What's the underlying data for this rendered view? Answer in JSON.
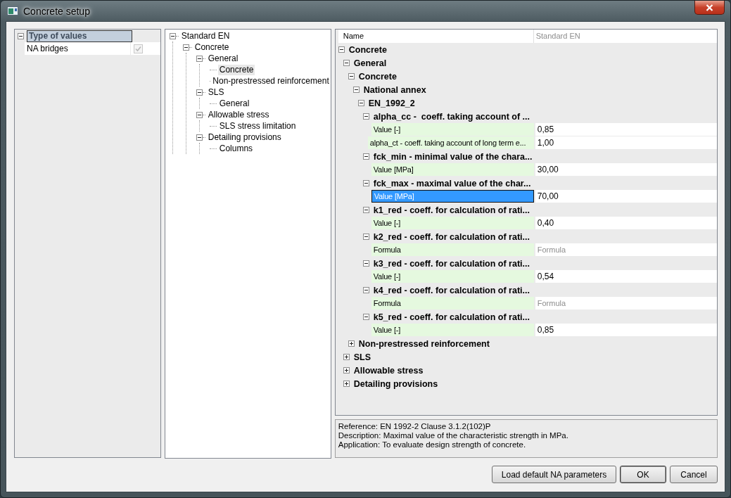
{
  "window": {
    "title": "Concrete setup"
  },
  "type_grid": {
    "category": {
      "label": "Type of values",
      "expanded": true,
      "selected": true
    },
    "items": [
      {
        "label": "NA bridges",
        "checked": true,
        "disabled": true
      }
    ]
  },
  "navigation_tree": {
    "items": [
      {
        "label": "Standard EN",
        "expanded": true,
        "selected": false,
        "children": [
          {
            "label": "Concrete",
            "expanded": true,
            "selected": false,
            "children": [
              {
                "label": "General",
                "expanded": true,
                "selected": false,
                "children": [
                  {
                    "label": "Concrete",
                    "selected": true
                  },
                  {
                    "label": "Non-prestressed reinforcement",
                    "selected": false
                  }
                ]
              },
              {
                "label": "SLS",
                "expanded": true,
                "selected": false,
                "children": [
                  {
                    "label": "General",
                    "selected": false
                  }
                ]
              },
              {
                "label": "Allowable stress",
                "expanded": true,
                "selected": false,
                "children": [
                  {
                    "label": "SLS stress limitation",
                    "selected": false
                  }
                ]
              },
              {
                "label": "Detailing provisions",
                "expanded": true,
                "selected": false,
                "children": [
                  {
                    "label": "Columns",
                    "selected": false
                  }
                ]
              }
            ]
          }
        ]
      }
    ]
  },
  "property_grid": {
    "columns": [
      "Name",
      "Standard EN"
    ],
    "rows": [
      {
        "kind": "category",
        "label": "Concrete",
        "expanded": true,
        "children": [
          {
            "kind": "category",
            "label": "General",
            "expanded": true,
            "children": [
              {
                "kind": "category",
                "label": "Concrete",
                "expanded": true,
                "children": [
                  {
                    "kind": "category",
                    "label": "National annex",
                    "expanded": true,
                    "children": [
                      {
                        "kind": "category",
                        "label": "EN_1992_2",
                        "expanded": true,
                        "children": [
                          {
                            "kind": "category",
                            "label": "alpha_cc -  coeff. taking account of ...",
                            "expanded": true,
                            "children": [
                              {
                                "kind": "value",
                                "label": "Value [-]",
                                "value": "0,85",
                                "selected": false,
                                "disabled": false
                              }
                            ]
                          },
                          {
                            "kind": "value",
                            "label": "alpha_ct - coeff. taking account of long term e...",
                            "value": "1,00",
                            "selected": false,
                            "disabled": false
                          },
                          {
                            "kind": "category",
                            "label": "fck_min - minimal value of the chara...",
                            "expanded": true,
                            "children": [
                              {
                                "kind": "value",
                                "label": "Value [MPa]",
                                "value": "30,00",
                                "selected": false,
                                "disabled": false
                              }
                            ]
                          },
                          {
                            "kind": "category",
                            "label": "fck_max - maximal value of the char...",
                            "expanded": true,
                            "children": [
                              {
                                "kind": "value",
                                "label": "Value [MPa]",
                                "value": "70,00",
                                "selected": true,
                                "disabled": false
                              }
                            ]
                          },
                          {
                            "kind": "category",
                            "label": "k1_red - coeff. for calculation of rati...",
                            "expanded": true,
                            "children": [
                              {
                                "kind": "value",
                                "label": "Value [-]",
                                "value": "0,40",
                                "selected": false,
                                "disabled": false
                              }
                            ]
                          },
                          {
                            "kind": "category",
                            "label": "k2_red - coeff. for calculation of rati...",
                            "expanded": true,
                            "children": [
                              {
                                "kind": "value",
                                "label": "Formula",
                                "value": "Formula",
                                "selected": false,
                                "disabled": true
                              }
                            ]
                          },
                          {
                            "kind": "category",
                            "label": "k3_red - coeff. for calculation of rati...",
                            "expanded": true,
                            "children": [
                              {
                                "kind": "value",
                                "label": "Value [-]",
                                "value": "0,54",
                                "selected": false,
                                "disabled": false
                              }
                            ]
                          },
                          {
                            "kind": "category",
                            "label": "k4_red - coeff. for calculation of rati...",
                            "expanded": true,
                            "children": [
                              {
                                "kind": "value",
                                "label": "Formula",
                                "value": "Formula",
                                "selected": false,
                                "disabled": true
                              }
                            ]
                          },
                          {
                            "kind": "category",
                            "label": "k5_red - coeff. for calculation of rati...",
                            "expanded": true,
                            "children": [
                              {
                                "kind": "value",
                                "label": "Value [-]",
                                "value": "0,85",
                                "selected": false,
                                "disabled": false
                              }
                            ]
                          }
                        ]
                      }
                    ]
                  }
                ]
              },
              {
                "kind": "category",
                "label": "Non-prestressed reinforcement",
                "expanded": false
              }
            ]
          },
          {
            "kind": "category",
            "label": "SLS",
            "expanded": false
          },
          {
            "kind": "category",
            "label": "Allowable stress",
            "expanded": false
          },
          {
            "kind": "category",
            "label": "Detailing provisions",
            "expanded": false
          }
        ]
      }
    ]
  },
  "description": {
    "lines": [
      "Reference: EN 1992-2 Clause 3.1.2(102)P",
      "Description: Maximal value of the characteristic strength in MPa.",
      "Application: To evaluate design strength of concrete."
    ]
  },
  "buttons": [
    {
      "label": "Load default NA parameters",
      "default": false
    },
    {
      "label": "OK",
      "default": true
    },
    {
      "label": "Cancel",
      "default": false
    }
  ]
}
